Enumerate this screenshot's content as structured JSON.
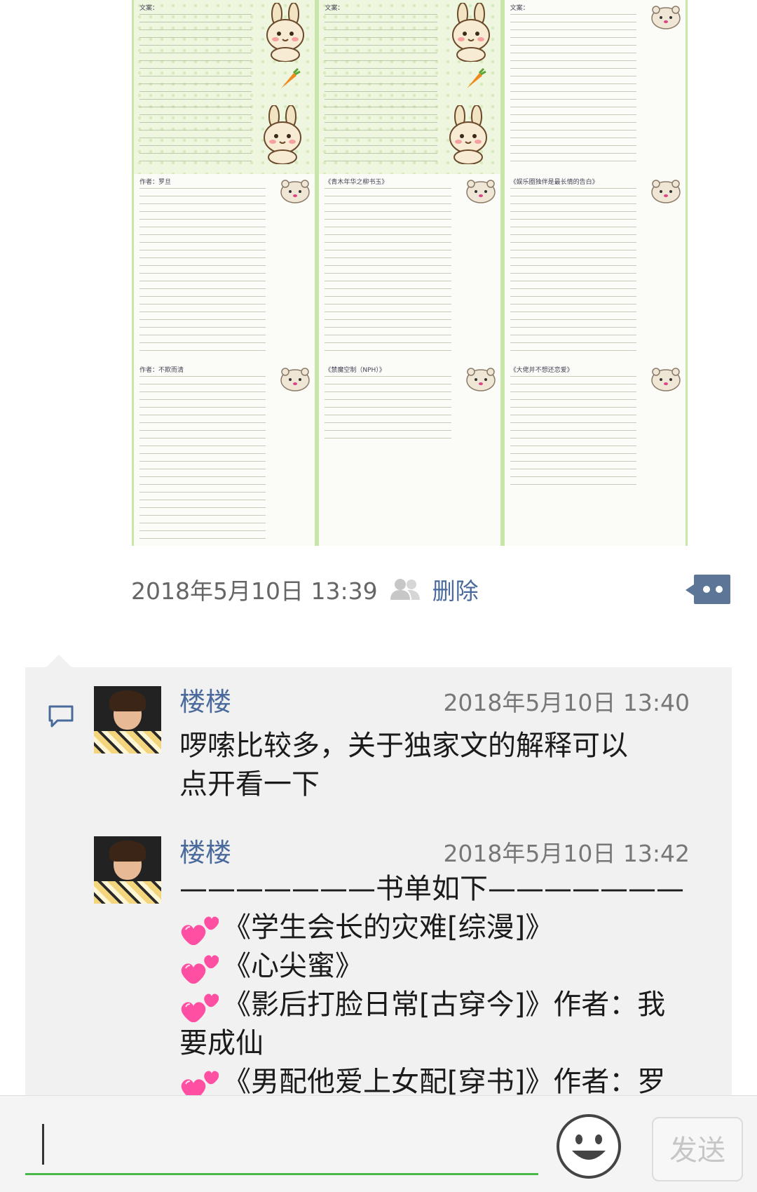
{
  "moment": {
    "timestamp": "2018年5月10日 13:39",
    "delete_label": "删除",
    "images": [
      {
        "style": "bunny",
        "snippet": "文案："
      },
      {
        "style": "bunny",
        "snippet": "文案："
      },
      {
        "style": "hamster",
        "snippet": "文案："
      },
      {
        "style": "hamster",
        "snippet": "作者：罗旦"
      },
      {
        "style": "hamster",
        "snippet": "《青木年华之柳书玉》"
      },
      {
        "style": "hamster",
        "snippet": "《娱乐圈独伴是最长情的告白》"
      },
      {
        "style": "hamster",
        "snippet": "作者：不欺而清"
      },
      {
        "style": "hamster",
        "snippet": "《禁魔空制（NPH）》"
      },
      {
        "style": "hamster",
        "snippet": "《大佬并不想还恋爱》"
      }
    ]
  },
  "comments": [
    {
      "author": "楼楼",
      "time": "2018年5月10日 13:40",
      "lines": [
        "啰嗦比较多，关于独家文的解释可以",
        "点开看一下"
      ]
    },
    {
      "author": "楼楼",
      "time": "2018年5月10日 13:42",
      "header": "———————书单如下———————",
      "books": [
        "《学生会长的灾难[综漫]》",
        "《心尖蜜》",
        "《影后打脸日常[古穿今]》作者：我",
        "《男配他爱上女配[穿书]》作者：罗"
      ],
      "continuation": "要成仙"
    }
  ],
  "input": {
    "value": "",
    "send_label": "发送"
  },
  "colors": {
    "link_blue": "#4a6a9c",
    "panel_bg": "#f1f1f1",
    "input_underline": "#48b949",
    "heart_pink": "#ff4fa3"
  }
}
